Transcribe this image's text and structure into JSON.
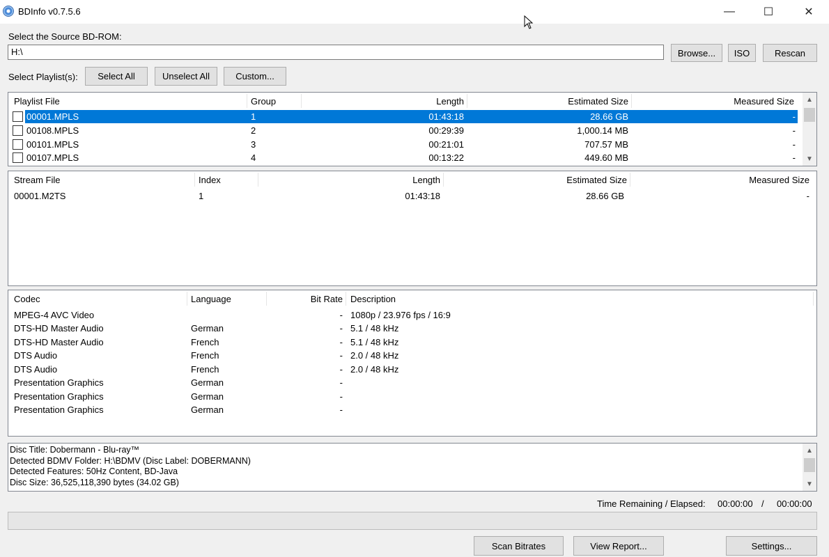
{
  "window": {
    "title": "BDInfo v0.7.5.6",
    "minimize": "—",
    "maximize": "☐",
    "close": "✕"
  },
  "source": {
    "label": "Select the Source BD-ROM:",
    "path": "H:\\",
    "browse": "Browse...",
    "iso": "ISO",
    "rescan": "Rescan"
  },
  "playlist_controls": {
    "label": "Select Playlist(s):",
    "select_all": "Select All",
    "unselect_all": "Unselect All",
    "custom": "Custom..."
  },
  "playlists": {
    "headers": [
      "Playlist File",
      "Group",
      "Length",
      "Estimated Size",
      "Measured Size"
    ],
    "rows": [
      {
        "file": "00001.MPLS",
        "group": "1",
        "length": "01:43:18",
        "est": "28.66 GB",
        "meas": "-"
      },
      {
        "file": "00108.MPLS",
        "group": "2",
        "length": "00:29:39",
        "est": "1,000.14 MB",
        "meas": "-"
      },
      {
        "file": "00101.MPLS",
        "group": "3",
        "length": "00:21:01",
        "est": "707.57 MB",
        "meas": "-"
      },
      {
        "file": "00107.MPLS",
        "group": "4",
        "length": "00:13:22",
        "est": "449.60 MB",
        "meas": "-"
      }
    ]
  },
  "streams": {
    "headers": [
      "Stream File",
      "Index",
      "Length",
      "Estimated Size",
      "Measured Size"
    ],
    "rows": [
      {
        "file": "00001.M2TS",
        "index": "1",
        "length": "01:43:18",
        "est": "28.66 GB",
        "meas": "-"
      }
    ]
  },
  "codecs": {
    "headers": [
      "Codec",
      "Language",
      "Bit Rate",
      "Description"
    ],
    "rows": [
      {
        "codec": "MPEG-4 AVC Video",
        "lang": "",
        "bitrate": "-",
        "desc": "1080p / 23.976 fps / 16:9"
      },
      {
        "codec": "DTS-HD Master Audio",
        "lang": "German",
        "bitrate": "-",
        "desc": "5.1 / 48 kHz"
      },
      {
        "codec": "DTS-HD Master Audio",
        "lang": "French",
        "bitrate": "-",
        "desc": "5.1 / 48 kHz"
      },
      {
        "codec": "DTS Audio",
        "lang": "French",
        "bitrate": "-",
        "desc": "2.0 / 48 kHz"
      },
      {
        "codec": "DTS Audio",
        "lang": "French",
        "bitrate": "-",
        "desc": "2.0 / 48 kHz"
      },
      {
        "codec": "Presentation Graphics",
        "lang": "German",
        "bitrate": "-",
        "desc": ""
      },
      {
        "codec": "Presentation Graphics",
        "lang": "German",
        "bitrate": "-",
        "desc": ""
      },
      {
        "codec": "Presentation Graphics",
        "lang": "German",
        "bitrate": "-",
        "desc": ""
      }
    ]
  },
  "log": [
    "Disc Title: Dobermann - Blu-ray™",
    "Detected BDMV Folder: H:\\BDMV (Disc Label: DOBERMANN)",
    "Detected Features: 50Hz Content, BD-Java",
    "Disc Size: 36,525,118,390 bytes (34.02 GB)"
  ],
  "time": {
    "label": "Time Remaining / Elapsed:",
    "remaining": "00:00:00",
    "sep": "/",
    "elapsed": "00:00:00"
  },
  "progress": 0,
  "bottom": {
    "scan": "Scan Bitrates",
    "report": "View Report...",
    "settings": "Settings..."
  }
}
